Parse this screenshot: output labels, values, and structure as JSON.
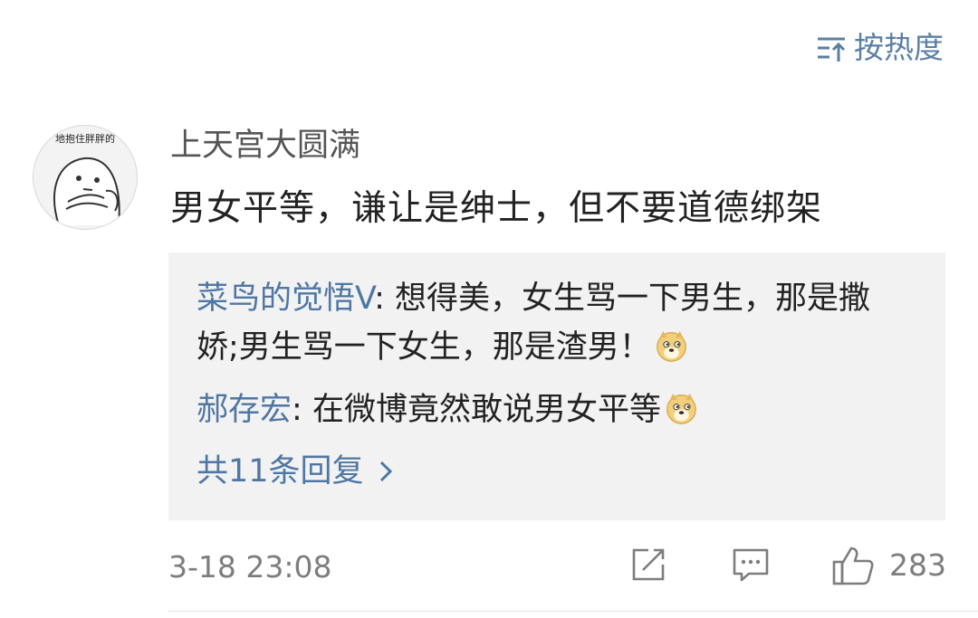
{
  "sort": {
    "label": "按热度",
    "icon": "sort-icon"
  },
  "comment": {
    "avatar_caption": "地抱住胖胖的",
    "username": "上天宫大圆满",
    "text": "男女平等，谦让是绅士，但不要道德绑架"
  },
  "replies": [
    {
      "author": "菜鸟的觉悟V",
      "separator": ": ",
      "text": "想得美，女生骂一下男生，那是撒娇;男生骂一下女生，那是渣男！",
      "emoji": "doge-emoji"
    },
    {
      "author": "郝存宏",
      "separator": ": ",
      "text": "在微博竟然敢说男女平等",
      "emoji": "doge-emoji"
    }
  ],
  "more_replies": {
    "label": "共11条回复",
    "icon": "chevron-right-icon"
  },
  "footer": {
    "time": "3-18 23:08",
    "like_count": "283",
    "share_icon": "share-icon",
    "reply_icon": "comment-icon",
    "like_icon": "thumbs-up-icon"
  },
  "colors": {
    "link": "#4f77a3",
    "sort": "#5a7fa6",
    "reply_bg": "#f2f2f2",
    "muted": "#7d7d7d"
  }
}
